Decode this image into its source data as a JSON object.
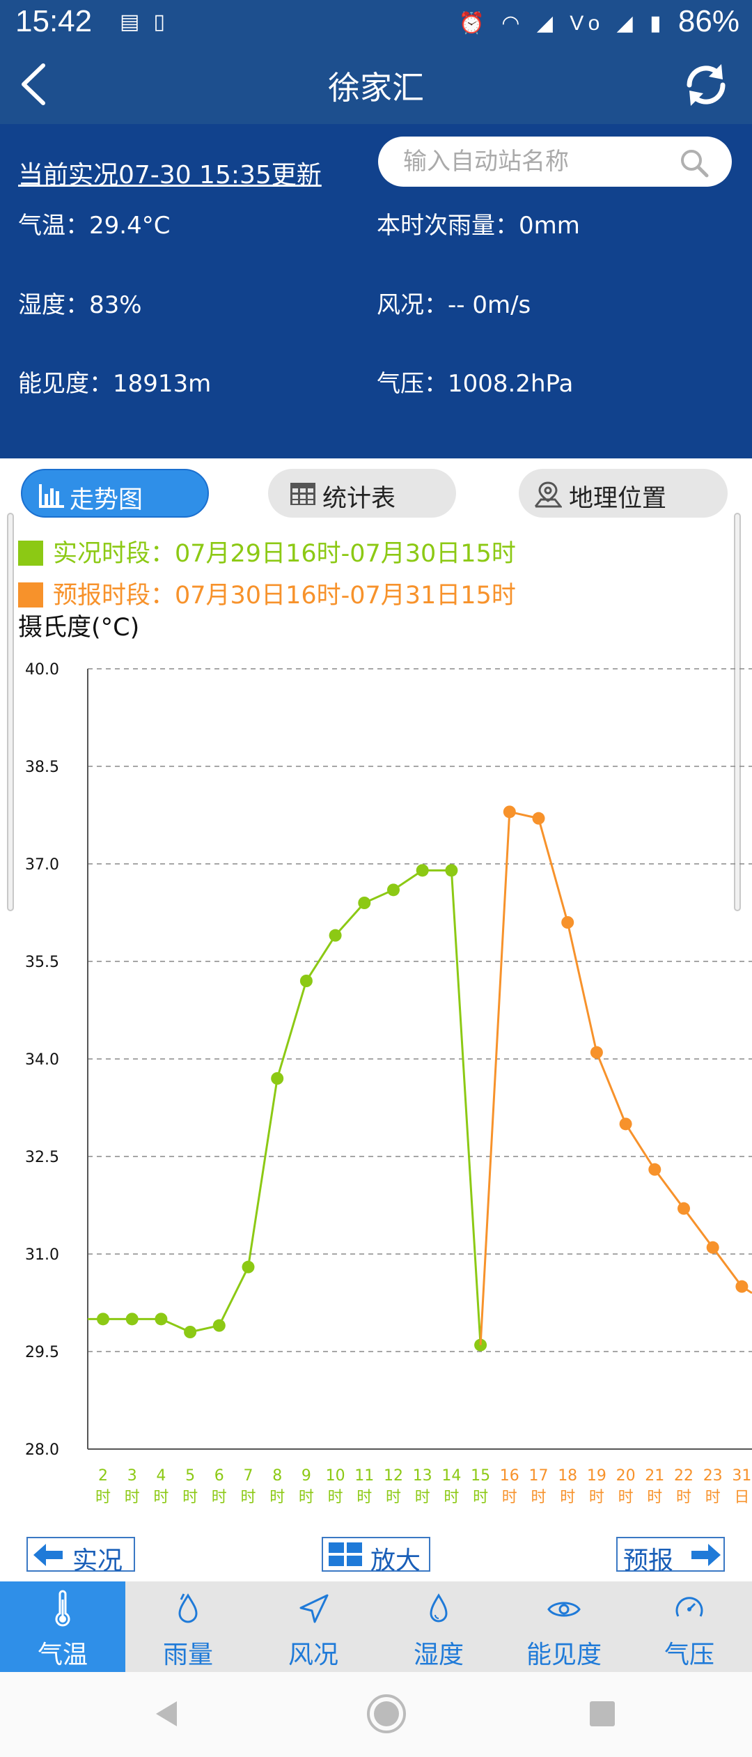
{
  "status_bar": {
    "time": "15:42",
    "battery": "86%",
    "notification_icons": [
      "message-icon",
      "sim-icon"
    ],
    "system_icons": [
      "alarm-icon",
      "wifi-icon",
      "signal-icon",
      "volte-icon",
      "signal-icon"
    ]
  },
  "header": {
    "title": "徐家汇"
  },
  "info": {
    "updated": "当前实况07-30 15:35更新",
    "search_placeholder": "输入自动站名称",
    "temperature": "气温：29.4°C",
    "rain": "本时次雨量：0mm",
    "humidity": "湿度：83%",
    "wind": "风况：--  0m/s",
    "visibility": "能见度：18913m",
    "pressure": "气压：1008.2hPa"
  },
  "tabs": [
    {
      "label": "走势图",
      "icon": "bar-chart-icon",
      "active": true
    },
    {
      "label": "统计表",
      "icon": "table-icon",
      "active": false
    },
    {
      "label": "地理位置",
      "icon": "map-pin-icon",
      "active": false
    }
  ],
  "legend": {
    "observed": "实况时段：07月29日16时-07月30日15时",
    "forecast": "预报时段：07月30日16时-07月31日15时"
  },
  "chart_data": {
    "type": "line",
    "ylabel": "摄氏度(°C)",
    "ylim": [
      28.0,
      40.0
    ],
    "yticks": [
      "40.0",
      "38.5",
      "37.0",
      "35.5",
      "34.0",
      "32.5",
      "31.0",
      "29.5",
      "28.0"
    ],
    "grid": true,
    "x_tick_labels": [
      {
        "top": "2",
        "bottom": "时",
        "series": "observed"
      },
      {
        "top": "3",
        "bottom": "时",
        "series": "observed"
      },
      {
        "top": "4",
        "bottom": "时",
        "series": "observed"
      },
      {
        "top": "5",
        "bottom": "时",
        "series": "observed"
      },
      {
        "top": "6",
        "bottom": "时",
        "series": "observed"
      },
      {
        "top": "7",
        "bottom": "时",
        "series": "observed"
      },
      {
        "top": "8",
        "bottom": "时",
        "series": "observed"
      },
      {
        "top": "9",
        "bottom": "时",
        "series": "observed"
      },
      {
        "top": "10",
        "bottom": "时",
        "series": "observed"
      },
      {
        "top": "11",
        "bottom": "时",
        "series": "observed"
      },
      {
        "top": "12",
        "bottom": "时",
        "series": "observed"
      },
      {
        "top": "13",
        "bottom": "时",
        "series": "observed"
      },
      {
        "top": "14",
        "bottom": "时",
        "series": "observed"
      },
      {
        "top": "15",
        "bottom": "时",
        "series": "observed"
      },
      {
        "top": "16",
        "bottom": "时",
        "series": "forecast"
      },
      {
        "top": "17",
        "bottom": "时",
        "series": "forecast"
      },
      {
        "top": "18",
        "bottom": "时",
        "series": "forecast"
      },
      {
        "top": "19",
        "bottom": "时",
        "series": "forecast"
      },
      {
        "top": "20",
        "bottom": "时",
        "series": "forecast"
      },
      {
        "top": "21",
        "bottom": "时",
        "series": "forecast"
      },
      {
        "top": "22",
        "bottom": "时",
        "series": "forecast"
      },
      {
        "top": "23",
        "bottom": "时",
        "series": "forecast"
      },
      {
        "top": "31",
        "bottom": "日",
        "series": "forecast"
      }
    ],
    "series": [
      {
        "series_key": "observed",
        "color": "#8cc914",
        "x": [
          2,
          3,
          4,
          5,
          6,
          7,
          8,
          9,
          10,
          11,
          12,
          13,
          14,
          15
        ],
        "values": [
          30.0,
          30.0,
          30.0,
          29.8,
          29.9,
          30.8,
          33.7,
          35.2,
          35.9,
          36.4,
          36.6,
          36.9,
          36.9,
          29.6
        ],
        "leading_value": 30.0
      },
      {
        "series_key": "forecast",
        "color": "#f7922b",
        "x": [
          15,
          16,
          17,
          18,
          19,
          20,
          21,
          22,
          23,
          24
        ],
        "values": [
          29.6,
          37.8,
          37.7,
          36.1,
          34.1,
          33.0,
          32.3,
          31.7,
          31.1,
          30.5
        ],
        "trailing_value": 30.4,
        "marker_from_index": 1
      }
    ]
  },
  "nav_buttons": {
    "prev": "实况",
    "zoom": "放大",
    "next": "预报"
  },
  "bottom_nav": [
    {
      "label": "气温",
      "icon": "thermometer-icon",
      "active": true
    },
    {
      "label": "雨量",
      "icon": "raindrop-icon",
      "active": false
    },
    {
      "label": "风况",
      "icon": "wind-direction-icon",
      "active": false
    },
    {
      "label": "湿度",
      "icon": "humidity-drop-icon",
      "active": false
    },
    {
      "label": "能见度",
      "icon": "eye-icon",
      "active": false
    },
    {
      "label": "气压",
      "icon": "pressure-gauge-icon",
      "active": false
    }
  ],
  "colors": {
    "header_bg": "#1d4f8e",
    "info_bg": "#11428d",
    "accent": "#2f8fe8",
    "observed": "#8cc914",
    "forecast": "#f7922b"
  }
}
